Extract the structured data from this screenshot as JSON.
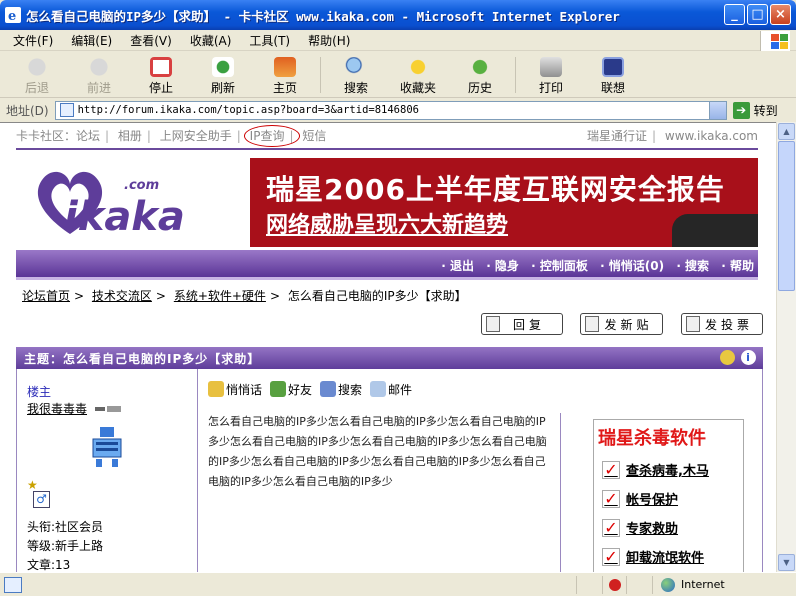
{
  "window": {
    "title": "怎么看自己电脑的IP多少【求助】 - 卡卡社区 www.ikaka.com - Microsoft Internet Explorer",
    "controls": [
      "_",
      "□",
      "×"
    ]
  },
  "menu": [
    "文件(F)",
    "编辑(E)",
    "查看(V)",
    "收藏(A)",
    "工具(T)",
    "帮助(H)"
  ],
  "toolbar": {
    "back": "后退",
    "forward": "前进",
    "stop": "停止",
    "refresh": "刷新",
    "home": "主页",
    "search": "搜索",
    "favorites": "收藏夹",
    "history": "历史",
    "print": "打印",
    "lianxiang": "联想"
  },
  "address": {
    "label": "地址(D)",
    "url": "http://forum.ikaka.com/topic.asp?board=3&artid=8146806",
    "go": "转到"
  },
  "topnav": {
    "items": [
      "卡卡社区：论坛",
      "相册",
      "上网安全助手",
      "IP查询",
      "短信"
    ],
    "right": [
      "瑞星通行证",
      "www.ikaka.com"
    ]
  },
  "banner": {
    "logo_sub": ".com",
    "logo_main": "ikaka",
    "ad_line1": "瑞星2006上半年度互联网安全报告",
    "ad_line2": "网络威胁呈现六大新趋势"
  },
  "purplebar": [
    "· 退出",
    "· 隐身",
    "· 控制面板",
    "· 悄悄话(0)",
    "· 搜索",
    "· 帮助"
  ],
  "breadcrumb": [
    "论坛首页",
    "技术交流区",
    "系统+软件+硬件",
    "怎么看自己电脑的IP多少【求助】"
  ],
  "actions": {
    "reply": "回复",
    "new_post": "发新贴",
    "vote": "发投票"
  },
  "topic": {
    "title": "主题：怎么看自己电脑的IP多少【求助】"
  },
  "author": {
    "role": "楼主",
    "name": "我很毒毒毒",
    "star": "★",
    "gender": "♂",
    "title": "头衔:社区会员",
    "level": "等级:新手上路",
    "posts": "文章:13"
  },
  "post_tools": [
    "悄悄话",
    "好友",
    "搜索",
    "邮件"
  ],
  "post_body": "怎么看自己电脑的IP多少怎么看自己电脑的IP多少怎么看自己电脑的IP多少怎么看自己电脑的IP多少怎么看自己电脑的IP多少怎么看自己电脑的IP多少怎么看自己电脑的IP多少怎么看自己电脑的IP多少怎么看自己电脑的IP多少怎么看自己电脑的IP多少",
  "side_ad": {
    "heading": "瑞星杀毒软件",
    "items": [
      "查杀病毒,木马",
      "帐号保护",
      "专家救助",
      "卸载流氓软件"
    ]
  },
  "status": {
    "zone": "Internet"
  },
  "colors": {
    "xp_blue": "#0a58d8",
    "forum_purple": "#5e3d9a",
    "ad_red": "#a8101a"
  }
}
